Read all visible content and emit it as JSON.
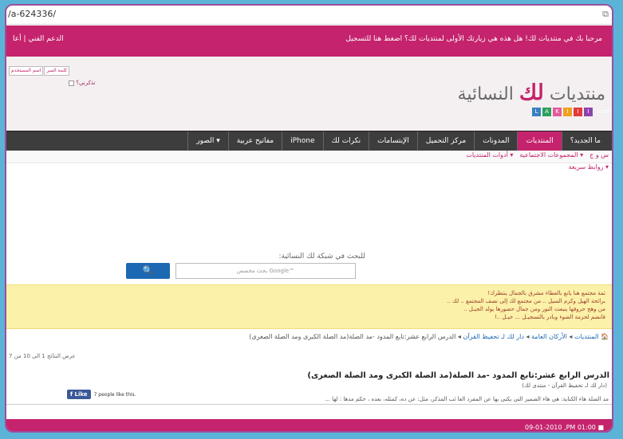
{
  "browser": {
    "url": "/a-624336/",
    "compat_icon": "compat-icon"
  },
  "topbar": {
    "welcome": "مرحبا بك في منتديات لك! هل هذه هي زيارتك الأولى لمنتديات لك؟ اضغط هنا للتسجيل",
    "support": "الدعم الفني | أعا"
  },
  "login": {
    "username_placeholder": "اسم المستخدم",
    "password_placeholder": "كلمة السر",
    "remember": "تذكرني؟"
  },
  "logo": {
    "prefix": "منتديات ",
    "accent": "لك",
    "suffix": " النسائية",
    "letters": [
      "L",
      "A",
      "K",
      "I",
      "I",
      "I"
    ],
    "dotcom": ".com"
  },
  "nav": {
    "tabs": [
      "ما الجديد؟",
      "المنتديات",
      "المدونات",
      "مركز التحميل",
      "الإبتسامات",
      "نكرات لك",
      "iPhone",
      "مفاتيح عربية",
      "الصور ▾"
    ],
    "active_index": 1
  },
  "subnav": {
    "items": [
      "س و ج",
      "المجموعات الاجتماعية ▾",
      "أدوات المنتديات ▾",
      "روابط سريعة ▾"
    ]
  },
  "search": {
    "label": "للبحث في شبكة لك النسائية:",
    "placeholder": "بحث مخصص Google™",
    "button": "🔍"
  },
  "notice": {
    "lines": [
      "ثمة مجتمع هنا يانع بالعطاء مشرق بالجمال ينتظرك!",
      "برائحة الهيل وكرم السيل .. من مجتمع لك إلى نصف المجتمع .. لك ..",
      "من وهج حروفها ينبعث النور ومن جمال حضورها يولد الجيـل ..",
      "فانضم لحزمة الضوء وبادر بالتسجيـل ... خيـل ..!"
    ]
  },
  "breadcrumb": {
    "home": "🏠",
    "items": [
      "المنتديات",
      "الأركان العامة",
      "دار لك لـ تحفيظ القرآن",
      "الدرس الرابع عشر:تابع المدود -مد الصلة(مد الصلة الكبرى ومد الصلة الصغرى)"
    ]
  },
  "results": "عرض النتائج 1 الى 10 من 7",
  "thread": {
    "title": "الدرس الرابع عشر:تابع المدود -مد الصلة(مد الصلة الكبرى ومد الصلة الصغرى)",
    "source": "(دار لك لـ تحفيظ القرآن - منتدى لك)",
    "snippet": "مد الصلة هاء الكناية: هي هاء الضمير التي يكنى بها عن المفرد الغا ئب المذكر، مثل: عن ده، كمثله، بعده ، حكم مدها : لها ..."
  },
  "like": {
    "button": "Like",
    "count": "7 people like this."
  },
  "footer": {
    "date": "09-01-2010 ,PM 01:00"
  },
  "colors": {
    "brand": "#c5236d",
    "nav": "#3d3d3d",
    "search_btn": "#1d68b2",
    "notice_bg": "#fbf1a8"
  }
}
